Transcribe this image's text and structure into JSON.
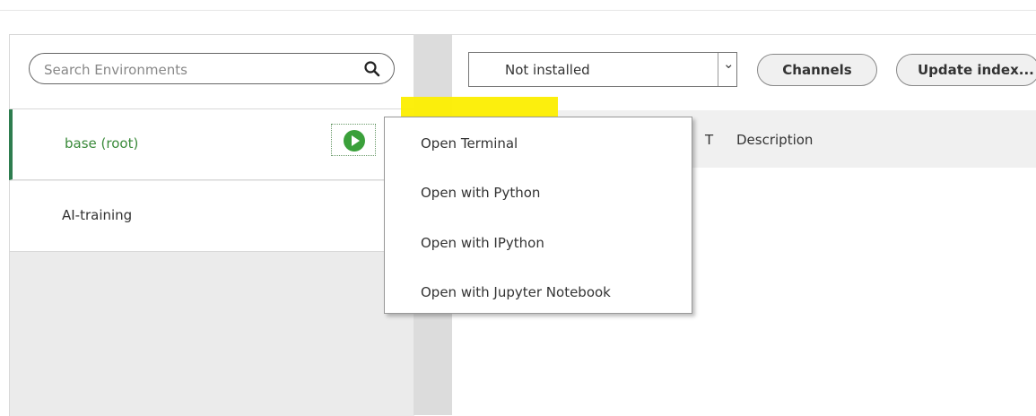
{
  "search": {
    "placeholder": "Search Environments"
  },
  "environments": [
    {
      "name": "base (root)",
      "active": true
    },
    {
      "name": "AI-training",
      "active": false
    }
  ],
  "packages": {
    "filter_value": "Not installed",
    "channels_label": "Channels",
    "update_label": "Update index...",
    "columns": [
      "T",
      "Description"
    ]
  },
  "context_menu": {
    "items": [
      {
        "label": "Open Terminal",
        "highlighted": true
      },
      {
        "label": "Open with Python"
      },
      {
        "label": "Open with IPython"
      },
      {
        "label": "Open with Jupyter Notebook"
      }
    ]
  },
  "colors": {
    "accent_green": "#2e7d4f",
    "play_green": "#3aa03a",
    "highlight_yellow": "#fcee00"
  }
}
